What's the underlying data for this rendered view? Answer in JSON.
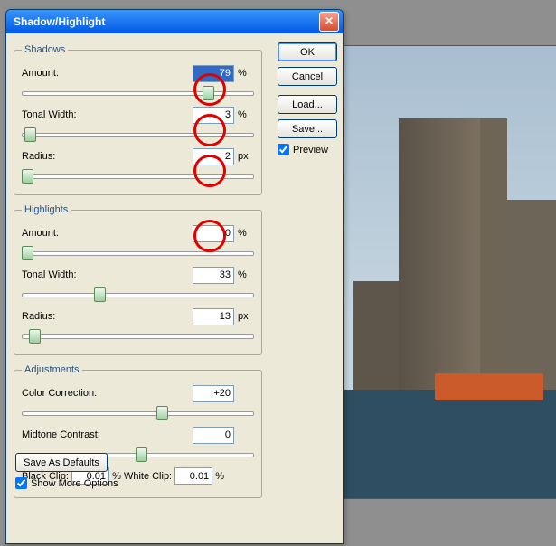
{
  "title": "Shadow/Highlight",
  "shadows": {
    "legend": "Shadows",
    "amount_label": "Amount:",
    "amount": "79",
    "amount_unit": "%",
    "tonal_label": "Tonal Width:",
    "tonal": "3",
    "tonal_unit": "%",
    "radius_label": "Radius:",
    "radius": "2",
    "radius_unit": "px"
  },
  "highlights": {
    "legend": "Highlights",
    "amount_label": "Amount:",
    "amount": "0",
    "amount_unit": "%",
    "tonal_label": "Tonal Width:",
    "tonal": "33",
    "tonal_unit": "%",
    "radius_label": "Radius:",
    "radius": "13",
    "radius_unit": "px"
  },
  "adjustments": {
    "legend": "Adjustments",
    "color_label": "Color Correction:",
    "color": "+20",
    "midtone_label": "Midtone Contrast:",
    "midtone": "0",
    "black_label": "Black Clip:",
    "black": "0.01",
    "bunit": "%",
    "white_label": "White Clip:",
    "white": "0.01",
    "wunit": "%"
  },
  "buttons": {
    "ok": "OK",
    "cancel": "Cancel",
    "load": "Load...",
    "save": "Save..."
  },
  "preview_label": "Preview",
  "save_defaults": "Save As Defaults",
  "show_more": "Show More Options"
}
